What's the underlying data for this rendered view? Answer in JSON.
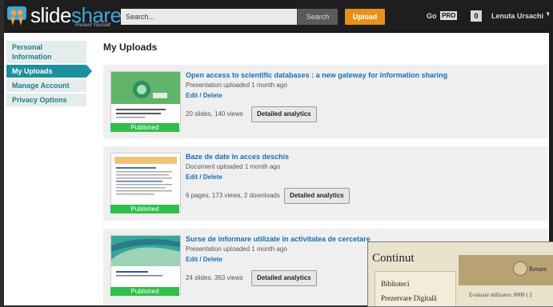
{
  "header": {
    "logo_text_main": "slide",
    "logo_text_accent": "share",
    "logo_tagline": "Present Yourself",
    "search_placeholder": "Search...",
    "search_button": "Search",
    "upload_button": "Upload",
    "go_label": "Go",
    "pro_badge": "PRO",
    "notification_count": "0",
    "username": "Lenuta Ursachi"
  },
  "sidebar": {
    "items": [
      {
        "label": "Personal Information"
      },
      {
        "label": "My Uploads"
      },
      {
        "label": "Manage Account"
      },
      {
        "label": "Privacy Options"
      }
    ]
  },
  "main": {
    "title": "My Uploads",
    "uploads": [
      {
        "title": "Open access to scientific databases : a new gateway for information sharing",
        "subtitle": "Presentation uploaded 1 month ago",
        "edit": "Edit / Delete",
        "stats": "20 slides, 140 views",
        "analytics_button": "Detailed analytics",
        "status": "Published"
      },
      {
        "title": "Baze de date în acces deschis",
        "subtitle": "Document uploaded 1 month ago",
        "edit": "Edit / Delete",
        "stats": "6 pages, 173 views, 2 downloads",
        "analytics_button": "Detailed analytics",
        "status": "Published"
      },
      {
        "title": "Surse de informare utilizate în activitatea de cercetare",
        "subtitle": "Presentation uploaded 1 month ago",
        "edit": "Edit / Delete",
        "stats": "24 slides, 363 views",
        "analytics_button": "Detailed analytics",
        "status": "Published"
      }
    ]
  },
  "overlay_window": {
    "title": "Continut",
    "links": [
      "Biblioteci",
      "Prezervare Digitală"
    ],
    "banner_text": "Resurs",
    "evaluation_text": "Evaluare utilizator: 0000 ( 2"
  },
  "colors": {
    "topbar": "#1e1e1e",
    "accent_blue": "#3fa6d6",
    "upload_orange": "#e8901c",
    "sidebar_active": "#1e8f9c",
    "link_blue": "#1a6fb3",
    "published_green": "#2fbf4a"
  }
}
